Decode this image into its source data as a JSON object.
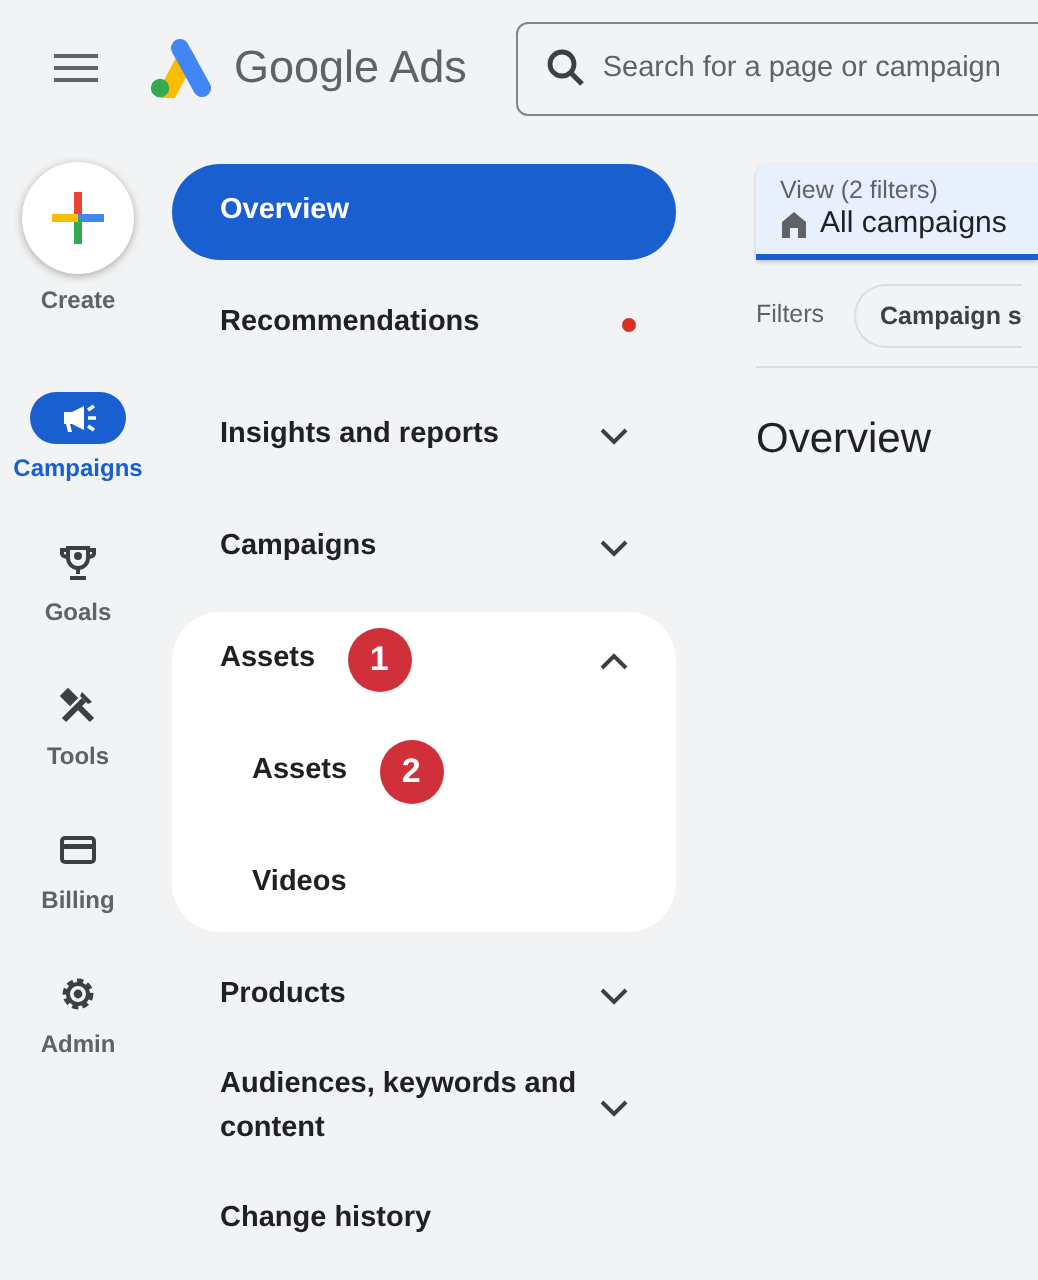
{
  "header": {
    "product": "Google Ads",
    "search": {
      "placeholder": "Search for a page or campaign"
    }
  },
  "rail": {
    "create": "Create",
    "items": [
      {
        "label": "Campaigns",
        "selected": true
      },
      {
        "label": "Goals",
        "selected": false
      },
      {
        "label": "Tools",
        "selected": false
      },
      {
        "label": "Billing",
        "selected": false
      },
      {
        "label": "Admin",
        "selected": false
      }
    ]
  },
  "nav": {
    "items": [
      {
        "label": "Overview",
        "selected": true
      },
      {
        "label": "Recommendations",
        "selected": false,
        "alert": true
      },
      {
        "label": "Insights and reports",
        "selected": false,
        "expanded": false
      },
      {
        "label": "Campaigns",
        "selected": false,
        "expanded": false
      },
      {
        "label": "Assets",
        "selected": false,
        "expanded": true,
        "marker": "1",
        "children": [
          {
            "label": "Assets",
            "selected": false,
            "marker": "2"
          },
          {
            "label": "Videos",
            "selected": false
          }
        ]
      },
      {
        "label": "Products",
        "selected": false,
        "expanded": false
      },
      {
        "label": "Audiences, keywords and content",
        "selected": false,
        "expanded": false
      },
      {
        "label": "Change history",
        "selected": false
      }
    ]
  },
  "main": {
    "view": {
      "caption": "View (2 filters)",
      "value": "All campaigns"
    },
    "filters": {
      "label": "Filters",
      "chips": [
        "Campaign s"
      ]
    },
    "heading": "Overview"
  }
}
